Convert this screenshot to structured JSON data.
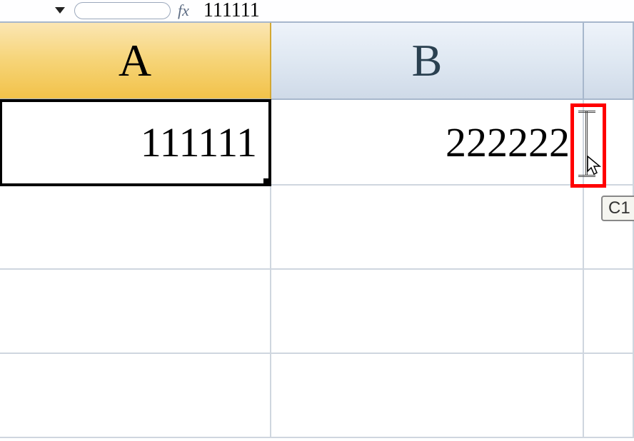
{
  "formula_bar": {
    "fx_label": "fx",
    "value": "111111"
  },
  "columns": {
    "a": "A",
    "b": "B"
  },
  "cells": {
    "a1": "111111",
    "b1": "222222"
  },
  "tooltip": "C1"
}
